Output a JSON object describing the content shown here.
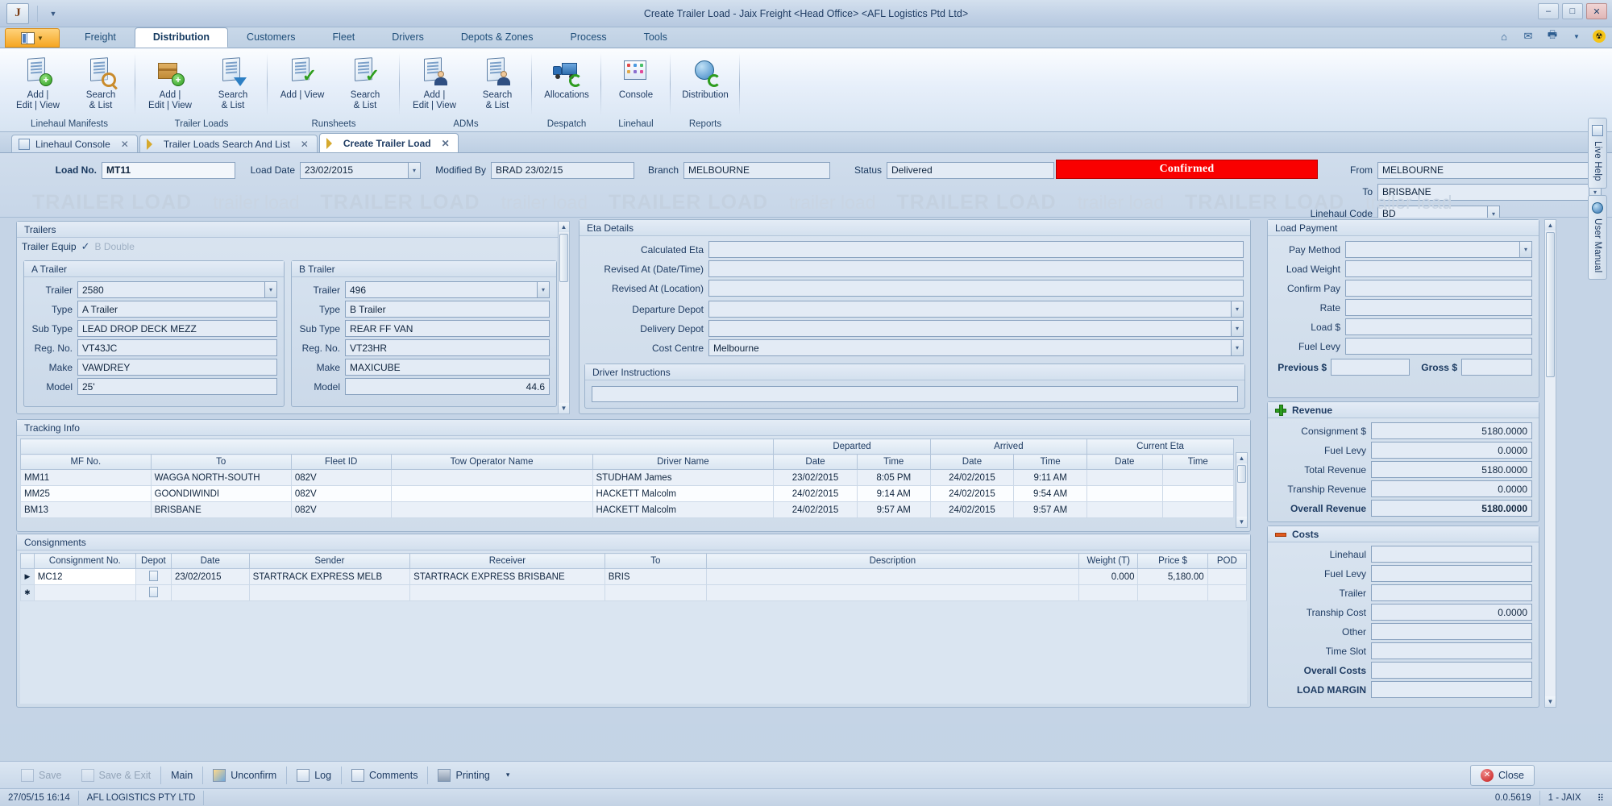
{
  "window": {
    "title": "Create Trailer Load - Jaix Freight <Head Office> <AFL Logistics Ptd Ltd>",
    "minimize": "–",
    "maximize": "□",
    "close": "✕"
  },
  "ribbon": {
    "file_tab": "",
    "tabs": [
      {
        "label": "Freight",
        "active": false
      },
      {
        "label": "Distribution",
        "active": true
      },
      {
        "label": "Customers",
        "active": false
      },
      {
        "label": "Fleet",
        "active": false
      },
      {
        "label": "Drivers",
        "active": false
      },
      {
        "label": "Depots & Zones",
        "active": false
      },
      {
        "label": "Process",
        "active": false
      },
      {
        "label": "Tools",
        "active": false
      }
    ],
    "groups": [
      {
        "label": "Linehaul Manifests",
        "buttons": [
          {
            "label": "Add |\nEdit | View",
            "icon": "document-add-icon"
          },
          {
            "label": "Search\n& List",
            "icon": "document-search-icon"
          }
        ]
      },
      {
        "label": "Trailer Loads",
        "buttons": [
          {
            "label": "Add |\nEdit | View",
            "icon": "box-add-icon"
          },
          {
            "label": "Search\n& List",
            "icon": "document-download-icon"
          }
        ]
      },
      {
        "label": "Runsheets",
        "buttons": [
          {
            "label": "Add | View",
            "icon": "document-check-icon"
          },
          {
            "label": "Search\n& List",
            "icon": "document-check-search-icon"
          }
        ]
      },
      {
        "label": "ADMs",
        "buttons": [
          {
            "label": "Add |\nEdit | View",
            "icon": "person-document-icon"
          },
          {
            "label": "Search\n& List",
            "icon": "person-document-search-icon"
          }
        ]
      },
      {
        "label": "Despatch",
        "buttons": [
          {
            "label": "Allocations",
            "icon": "truck-icon"
          }
        ]
      },
      {
        "label": "Linehaul",
        "buttons": [
          {
            "label": "Console",
            "icon": "console-grid-icon"
          }
        ]
      },
      {
        "label": "Reports",
        "buttons": [
          {
            "label": "Distribution",
            "icon": "globe-refresh-icon"
          }
        ]
      }
    ],
    "right_icons": [
      "home-icon",
      "mail-icon",
      "printer-icon",
      "radiation-icon"
    ]
  },
  "doc_tabs": [
    {
      "label": "Linehaul Console",
      "icon": "console-icon",
      "active": false,
      "close": "✕"
    },
    {
      "label": "Trailer Loads Search And List",
      "icon": "leaf-icon",
      "active": false,
      "close": "✕"
    },
    {
      "label": "Create Trailer Load",
      "icon": "leaf-icon",
      "active": true,
      "close": "✕"
    }
  ],
  "doc_tabs_close_all": "✕",
  "header": {
    "load_no_label": "Load No.",
    "load_no": "MT11",
    "load_date_label": "Load Date",
    "load_date": "23/02/2015",
    "modified_by_label": "Modified By",
    "modified_by": "BRAD 23/02/15",
    "branch_label": "Branch",
    "branch": "MELBOURNE",
    "status_label": "Status",
    "status": "Delivered",
    "confirmed_badge": "Confirmed",
    "confirmed_color": "#f90000",
    "from_label": "From",
    "from": "MELBOURNE",
    "to_label": "To",
    "to": "BRISBANE",
    "linehaul_code_label": "Linehaul Code",
    "linehaul_code": "BD",
    "watermark_big": "TRAILER LOAD",
    "watermark_small": "trailer load"
  },
  "trailers": {
    "title": "Trailers",
    "trailer_equip_label": "Trailer Equip",
    "trailer_equip_checked": "✓",
    "trailer_equip_value": "B Double",
    "a_trailer": {
      "title": "A Trailer",
      "fields": [
        {
          "label": "Trailer",
          "value": "2580",
          "combo": true
        },
        {
          "label": "Type",
          "value": "A Trailer",
          "combo": false
        },
        {
          "label": "Sub Type",
          "value": "LEAD DROP DECK MEZZ",
          "combo": false
        },
        {
          "label": "Reg. No.",
          "value": "VT43JC",
          "combo": false
        },
        {
          "label": "Make",
          "value": "VAWDREY",
          "combo": false
        },
        {
          "label": "Model",
          "value": "25'",
          "combo": false
        }
      ]
    },
    "b_trailer": {
      "title": "B Trailer",
      "fields": [
        {
          "label": "Trailer",
          "value": "496",
          "combo": true
        },
        {
          "label": "Type",
          "value": "B Trailer",
          "combo": false
        },
        {
          "label": "Sub Type",
          "value": "REAR FF VAN",
          "combo": false
        },
        {
          "label": "Reg. No.",
          "value": "VT23HR",
          "combo": false
        },
        {
          "label": "Make",
          "value": "MAXICUBE",
          "combo": false
        },
        {
          "label": "Model",
          "value": "44.6",
          "combo": false
        }
      ]
    }
  },
  "eta": {
    "title": "Eta Details",
    "fields": [
      {
        "label": "Calculated Eta",
        "value": "",
        "combo": false
      },
      {
        "label": "Revised At (Date/Time)",
        "value": "",
        "combo": false
      },
      {
        "label": "Revised At (Location)",
        "value": "",
        "combo": false
      }
    ],
    "depot_fields": [
      {
        "label": "Departure Depot",
        "value": "",
        "combo": true
      },
      {
        "label": "Delivery Depot",
        "value": "",
        "combo": true
      },
      {
        "label": "Cost Centre",
        "value": "Melbourne",
        "combo": true
      }
    ],
    "driver_instructions_title": "Driver Instructions",
    "driver_instructions": ""
  },
  "tracking": {
    "title": "Tracking Info",
    "group_headers": [
      {
        "label": "",
        "span": 5
      },
      {
        "label": "Departed",
        "span": 2
      },
      {
        "label": "Arrived",
        "span": 2
      },
      {
        "label": "Current Eta",
        "span": 2
      }
    ],
    "columns": [
      "MF No.",
      "To",
      "Fleet ID",
      "Tow Operator Name",
      "Driver Name",
      "Date",
      "Time",
      "Date",
      "Time",
      "Date",
      "Time"
    ],
    "rows": [
      [
        "MM11",
        "WAGGA NORTH-SOUTH",
        "082V",
        "",
        "STUDHAM James",
        "23/02/2015",
        "8:05 PM",
        "24/02/2015",
        "9:11 AM",
        "",
        ""
      ],
      [
        "MM25",
        "GOONDIWINDI",
        "082V",
        "",
        "HACKETT Malcolm",
        "24/02/2015",
        "9:14 AM",
        "24/02/2015",
        "9:54 AM",
        "",
        ""
      ],
      [
        "BM13",
        "BRISBANE",
        "082V",
        "",
        "HACKETT Malcolm",
        "24/02/2015",
        "9:57 AM",
        "24/02/2015",
        "9:57 AM",
        "",
        ""
      ]
    ]
  },
  "consignments": {
    "title": "Consignments",
    "columns": [
      "",
      "Consignment No.",
      "Depot",
      "Date",
      "Sender",
      "Receiver",
      "To",
      "Description",
      "Weight (T)",
      "Price $",
      "POD"
    ],
    "rows": [
      {
        "marker": "▶",
        "cells": [
          "MC12",
          "",
          "23/02/2015",
          "STARTRACK EXPRESS MELB",
          "STARTRACK EXPRESS BRISBANE",
          "BRIS",
          "",
          "0.000",
          "5,180.00",
          ""
        ]
      },
      {
        "marker": "✱",
        "cells": [
          "",
          "",
          "",
          "",
          "",
          "",
          "",
          "",
          "",
          ""
        ]
      }
    ]
  },
  "load_payment": {
    "title": "Load Payment",
    "fields": [
      {
        "label": "Pay Method",
        "value": "",
        "combo": true
      },
      {
        "label": "Load Weight",
        "value": "",
        "combo": false
      },
      {
        "label": "Confirm Pay",
        "value": "",
        "combo": false
      },
      {
        "label": "Rate",
        "value": "",
        "combo": false
      },
      {
        "label": "Load $",
        "value": "",
        "combo": false
      },
      {
        "label": "Fuel Levy",
        "value": "",
        "combo": false
      }
    ],
    "previous_label": "Previous $",
    "previous_value": "",
    "gross_label": "Gross $",
    "gross_value": ""
  },
  "revenue": {
    "title": "Revenue",
    "icon": "plus-icon",
    "icon_color": "#2d9c1f",
    "fields": [
      {
        "label": "Consignment $",
        "value": "5180.0000",
        "bold": false
      },
      {
        "label": "Fuel Levy",
        "value": "0.0000",
        "bold": false
      },
      {
        "label": "Total Revenue",
        "value": "5180.0000",
        "bold": false
      },
      {
        "label": "Tranship Revenue",
        "value": "0.0000",
        "bold": false
      },
      {
        "label": "Overall Revenue",
        "value": "5180.0000",
        "bold": true
      }
    ]
  },
  "costs": {
    "title": "Costs",
    "icon": "minus-icon",
    "icon_color": "#e05a1e",
    "fields": [
      {
        "label": "Linehaul",
        "value": "",
        "bold": false
      },
      {
        "label": "Fuel Levy",
        "value": "",
        "bold": false
      },
      {
        "label": "Trailer",
        "value": "",
        "bold": false
      },
      {
        "label": "Tranship Cost",
        "value": "0.0000",
        "bold": false
      },
      {
        "label": "Other",
        "value": "",
        "bold": false
      },
      {
        "label": "Time Slot",
        "value": "",
        "bold": false
      },
      {
        "label": "Overall Costs",
        "value": "",
        "bold": true
      },
      {
        "label": "LOAD MARGIN",
        "value": "",
        "bold": true
      }
    ]
  },
  "rail": [
    {
      "label": "Live Help",
      "icon": "help-window-icon"
    },
    {
      "label": "User Manual",
      "icon": "globe-icon"
    }
  ],
  "bottom_toolbar": [
    {
      "label": "Save",
      "icon": "save-icon",
      "disabled": true
    },
    {
      "label": "Save & Exit",
      "icon": "save-exit-icon",
      "disabled": true
    },
    {
      "label": "Main",
      "icon": "",
      "disabled": false
    },
    {
      "label": "Unconfirm",
      "icon": "unconfirm-icon",
      "disabled": false
    },
    {
      "label": "Log",
      "icon": "log-icon",
      "disabled": false
    },
    {
      "label": "Comments",
      "icon": "comments-icon",
      "disabled": false
    },
    {
      "label": "Printing",
      "icon": "printer-icon",
      "disabled": false
    }
  ],
  "bottom_toolbar_more": "▾",
  "close_button": {
    "label": "Close",
    "icon": "close-circle-icon"
  },
  "statusbar": {
    "datetime": "27/05/15 16:14",
    "company": "AFL LOGISTICS PTY LTD",
    "version": "0.0.5619",
    "session": "1 - JAIX"
  }
}
